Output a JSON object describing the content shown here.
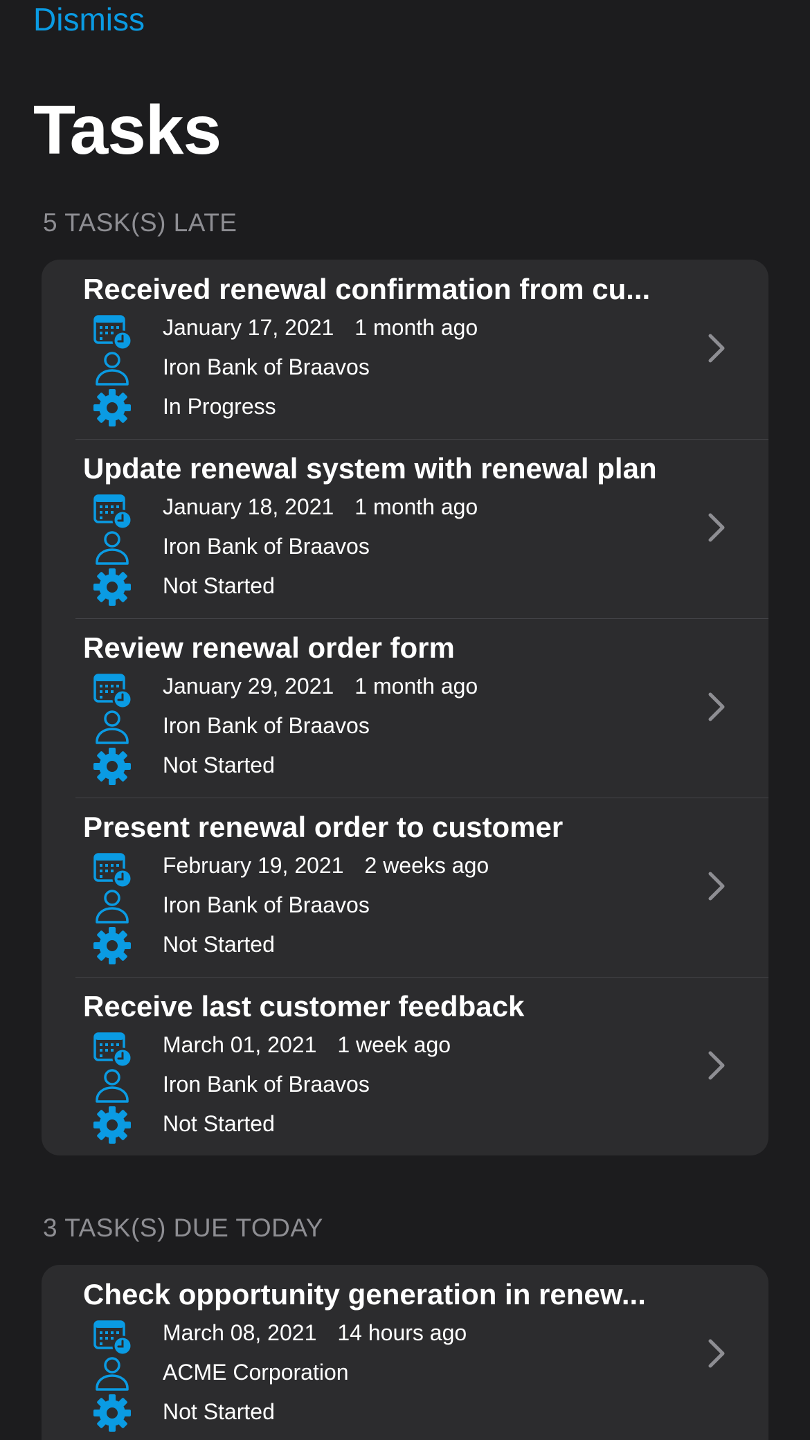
{
  "header": {
    "dismiss_label": "Dismiss",
    "title": "Tasks"
  },
  "colors": {
    "background": "#1c1c1e",
    "card": "#2c2c2e",
    "accent": "#0a9be3",
    "section_header": "#8e8e93"
  },
  "icons": {
    "date": "calendar-clock-icon",
    "account": "person-icon",
    "status": "gear-icon",
    "disclosure": "chevron-right-icon"
  },
  "sections": [
    {
      "header": "5 TASK(S) LATE",
      "tasks": [
        {
          "title": "Received renewal confirmation from cu...",
          "date": "January 17, 2021",
          "relative": "1 month ago",
          "account": "Iron Bank of Braavos",
          "status": "In Progress"
        },
        {
          "title": "Update renewal system with renewal plan",
          "date": "January 18, 2021",
          "relative": "1 month ago",
          "account": "Iron Bank of Braavos",
          "status": "Not Started"
        },
        {
          "title": "Review renewal order form",
          "date": "January 29, 2021",
          "relative": "1 month ago",
          "account": "Iron Bank of Braavos",
          "status": "Not Started"
        },
        {
          "title": "Present renewal order to customer",
          "date": "February 19, 2021",
          "relative": "2 weeks ago",
          "account": "Iron Bank of Braavos",
          "status": "Not Started"
        },
        {
          "title": "Receive last customer feedback",
          "date": "March 01, 2021",
          "relative": "1 week ago",
          "account": "Iron Bank of Braavos",
          "status": "Not Started"
        }
      ]
    },
    {
      "header": "3 TASK(S) DUE TODAY",
      "tasks": [
        {
          "title": "Check opportunity generation in renew...",
          "date": "March 08, 2021",
          "relative": "14 hours ago",
          "account": "ACME Corporation",
          "status": "Not Started"
        }
      ]
    }
  ]
}
